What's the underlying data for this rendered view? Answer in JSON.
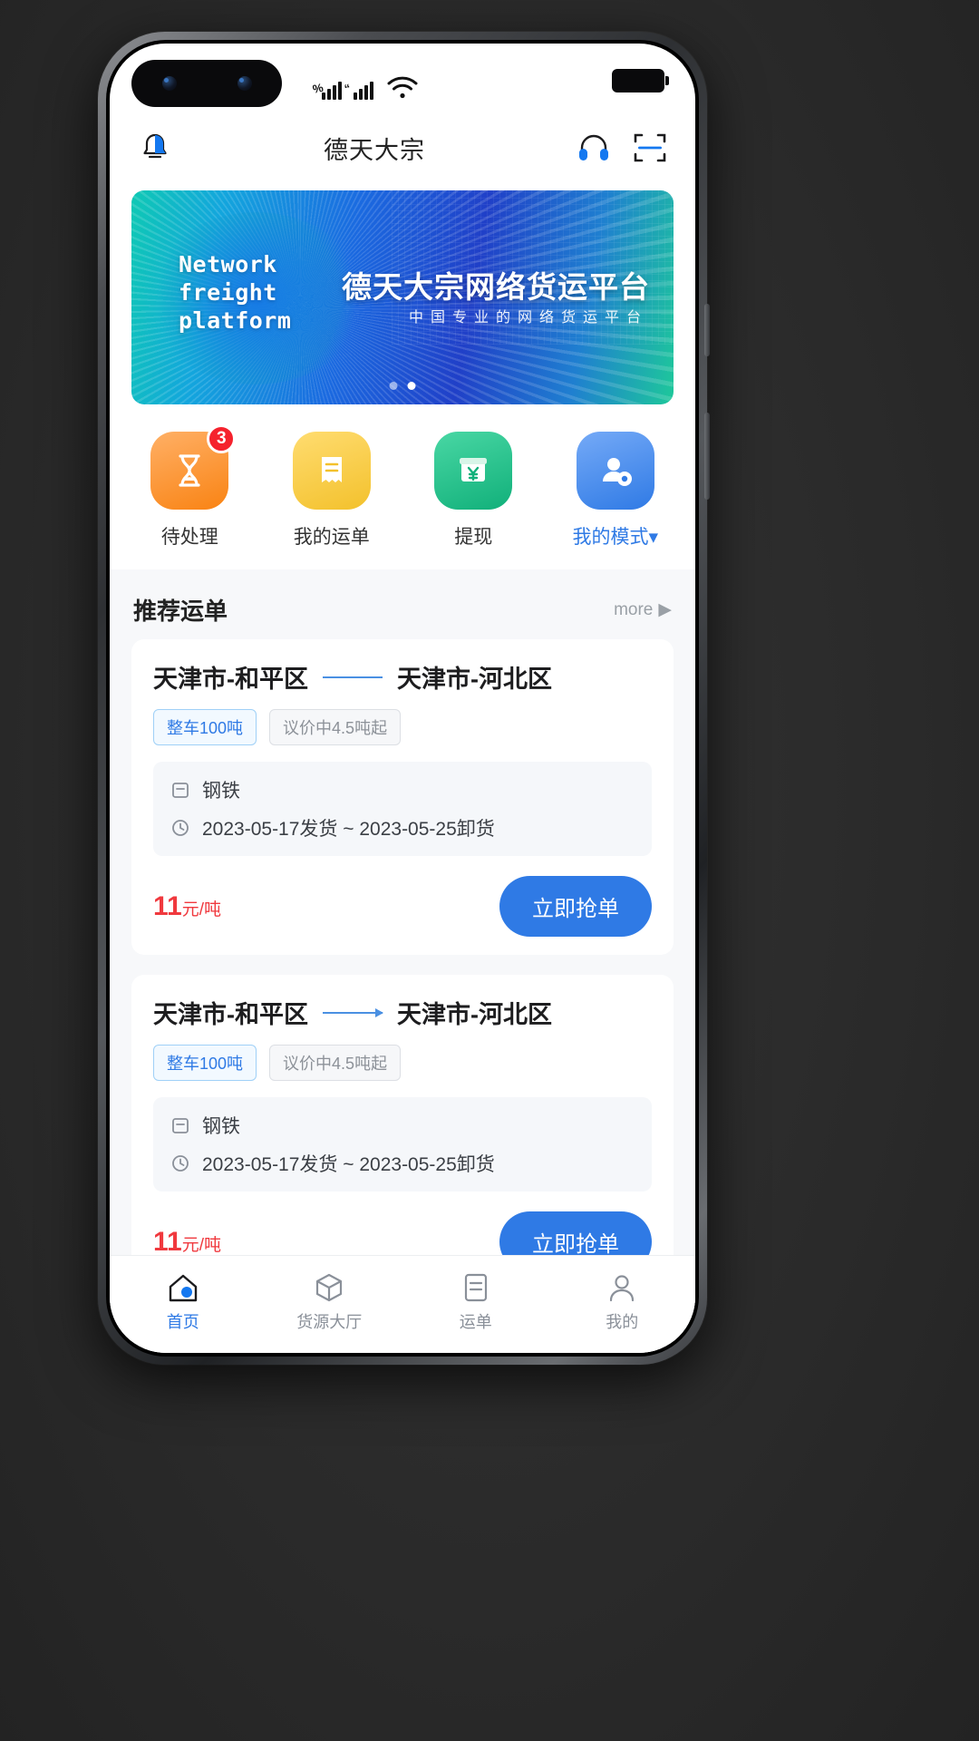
{
  "status_bar": {
    "signal_1": "signal-bars-icon",
    "signal_2": "signal-bars-icon",
    "wifi": "wifi-icon",
    "battery": "battery-icon"
  },
  "header": {
    "title": "德天大宗",
    "bell_icon": "bell-icon",
    "headset_icon": "headset-icon",
    "scan_icon": "scan-icon"
  },
  "banner": {
    "en_line1": "Network",
    "en_line2": "freight",
    "en_line3": "platform",
    "cn_title": "德天大宗网络货运平台",
    "cn_subtitle": "中国专业的网络货运平台",
    "dots": [
      "",
      ""
    ]
  },
  "quick_actions": [
    {
      "label": "待处理",
      "icon": "hourglass-icon",
      "color": "#f98313",
      "badge": "3"
    },
    {
      "label": "我的运单",
      "icon": "receipt-icon",
      "color": "#f3c12c",
      "badge": ""
    },
    {
      "label": "提现",
      "icon": "yuan-withdraw-icon",
      "color": "#11b07a",
      "badge": ""
    },
    {
      "label": "我的模式",
      "icon": "user-settings-icon",
      "color": "#2f7ae5",
      "badge": "",
      "caret": "▾"
    }
  ],
  "section": {
    "title": "推荐运单",
    "more_label": "more",
    "more_icon": "chevron-right-icon"
  },
  "orders": [
    {
      "from": "天津市-和平区",
      "to": "天津市-河北区",
      "tags": [
        "整车100吨",
        "议价中4.5吨起"
      ],
      "cargo_icon": "package-icon",
      "cargo": "钢铁",
      "time_icon": "clock-icon",
      "time": "2023-05-17发货 ~ 2023-05-25卸货",
      "price": "11",
      "price_unit": "元/吨",
      "action": "立即抢单"
    },
    {
      "from": "天津市-和平区",
      "to": "天津市-河北区",
      "tags": [
        "整车100吨",
        "议价中4.5吨起"
      ],
      "cargo_icon": "package-icon",
      "cargo": "钢铁",
      "time_icon": "clock-icon",
      "time": "2023-05-17发货 ~ 2023-05-25卸货",
      "price": "11",
      "price_unit": "元/吨",
      "action": "立即抢单"
    }
  ],
  "tabbar": [
    {
      "label": "首页",
      "icon": "home-icon",
      "active": true
    },
    {
      "label": "货源大厅",
      "icon": "box-icon",
      "active": false
    },
    {
      "label": "运单",
      "icon": "list-icon",
      "active": false
    },
    {
      "label": "我的",
      "icon": "person-icon",
      "active": false
    }
  ],
  "colors": {
    "accent": "#2f7ae5",
    "price": "#f0393e",
    "badge": "#f5222d"
  }
}
